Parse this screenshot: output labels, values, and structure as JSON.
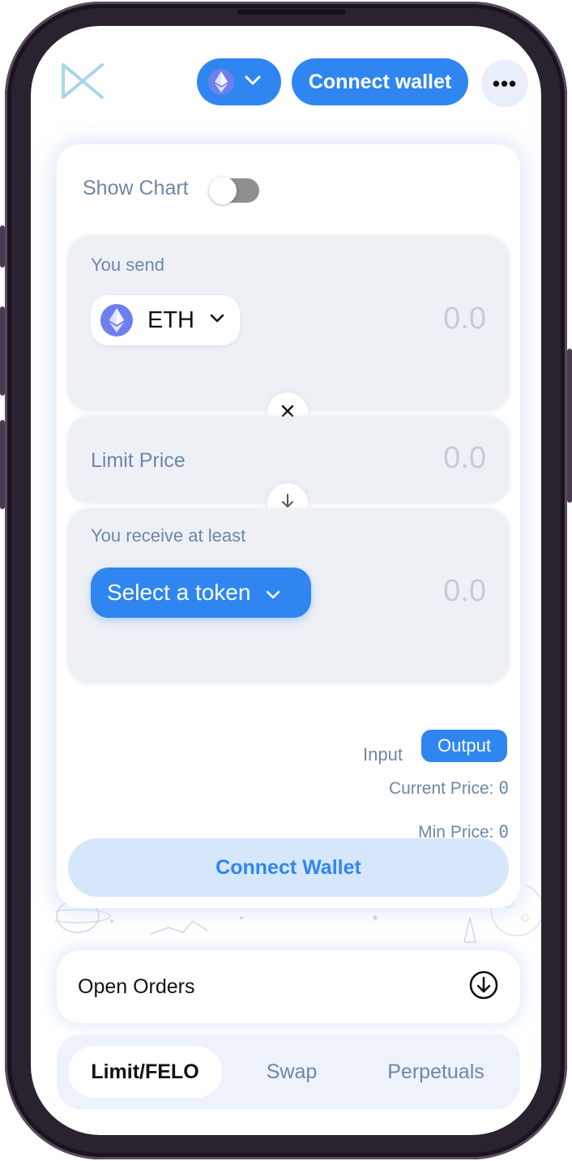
{
  "header": {
    "chain": "ETH",
    "connect_label": "Connect wallet",
    "more_label": "•••"
  },
  "card": {
    "show_chart_label": "Show Chart",
    "show_chart_on": false,
    "send": {
      "label": "You send",
      "token": "ETH",
      "amount": "0.0"
    },
    "limit": {
      "label": "Limit Price",
      "amount": "0.0"
    },
    "receive": {
      "label": "You receive at least",
      "select_label": "Select a token",
      "amount": "0.0"
    },
    "price_mode": {
      "input_label": "Input",
      "output_label": "Output",
      "selected": "Output"
    },
    "current_price_label": "Current Price:",
    "current_price_value": "0",
    "min_price_label": "Min Price:",
    "min_price_value": "0",
    "connect_wallet_label": "Connect Wallet"
  },
  "open_orders": {
    "label": "Open Orders"
  },
  "bottom_nav": {
    "tabs": [
      {
        "label": "Limit/FELO",
        "active": true
      },
      {
        "label": "Swap",
        "active": false
      },
      {
        "label": "Perpetuals",
        "active": false
      }
    ]
  },
  "colors": {
    "accent": "#2f86f0",
    "label": "#6f86a8",
    "panel": "#edf1f6",
    "frame": "#2b2230"
  },
  "icons": [
    "logo-icon",
    "eth-icon",
    "chevron-down-icon",
    "more-icon",
    "close-icon",
    "arrow-down-icon",
    "arrow-down-circle-icon"
  ]
}
